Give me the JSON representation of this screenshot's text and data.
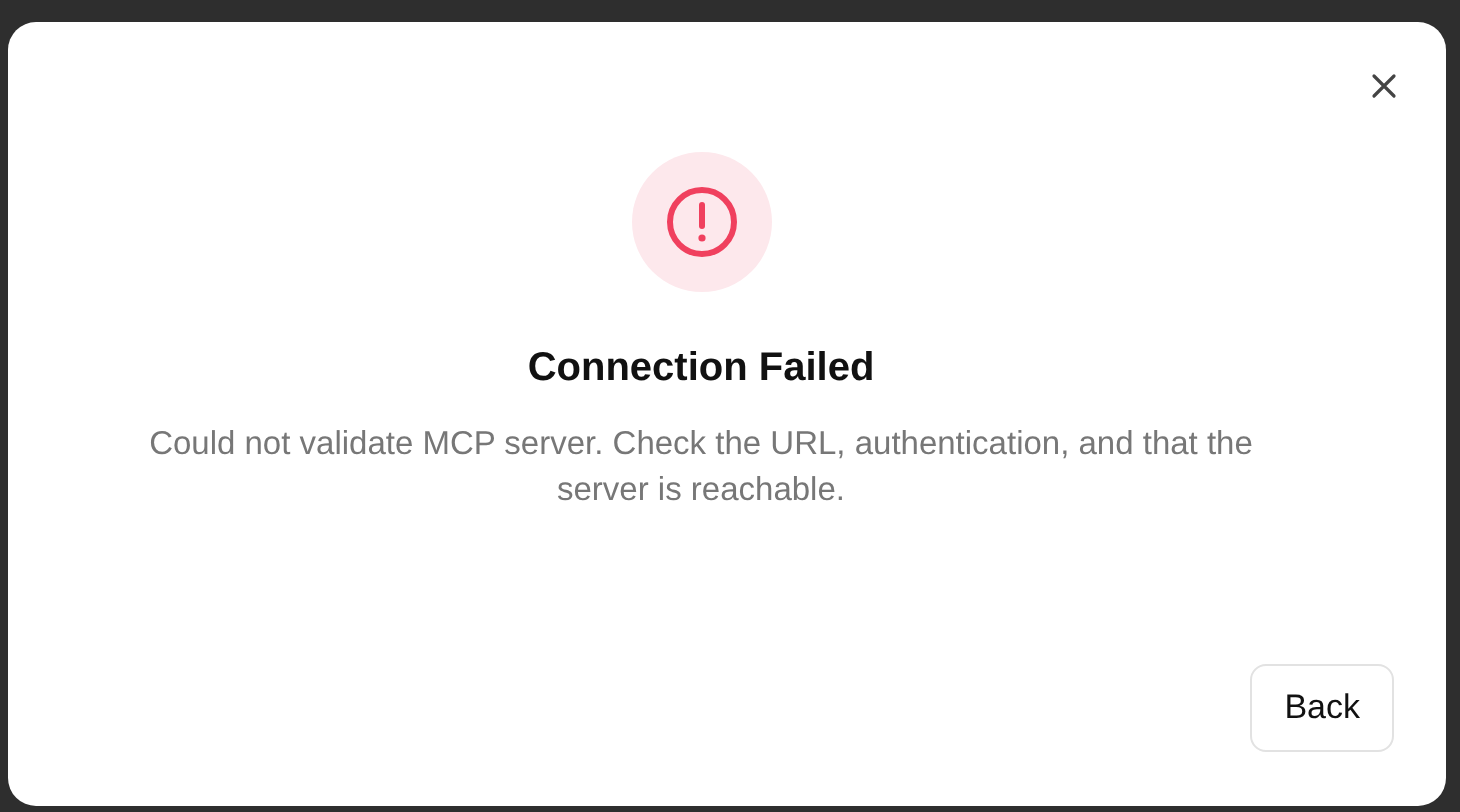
{
  "dialog": {
    "title": "Connection Failed",
    "message": "Could not validate MCP server. Check the URL, authentication, and that the server is reachable.",
    "buttons": [
      "Back"
    ]
  }
}
